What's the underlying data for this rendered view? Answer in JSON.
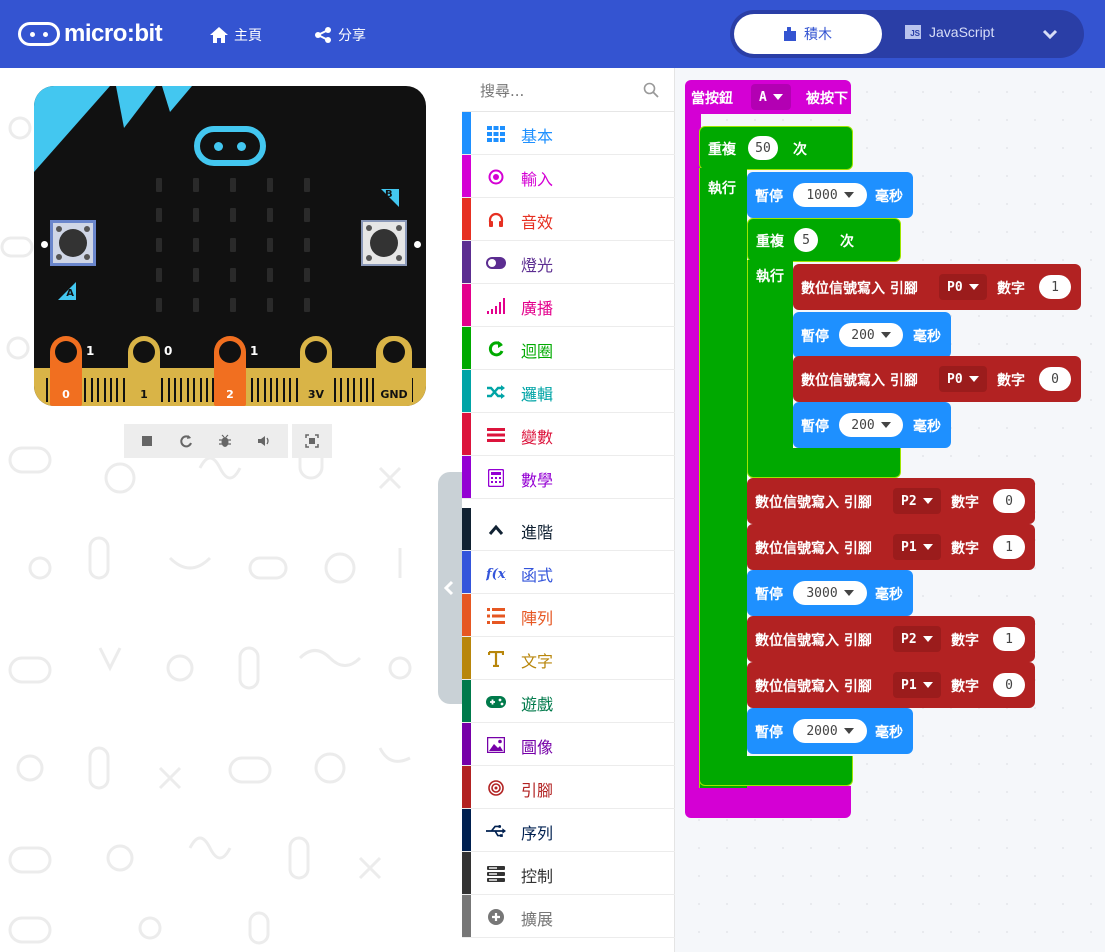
{
  "header": {
    "logo_text": "micro:bit",
    "home_label": "主頁",
    "share_label": "分享",
    "blocks_tab_label": "積木",
    "js_tab_label": "JavaScript",
    "js_badge": "JS"
  },
  "simulator": {
    "button_a_label": "A",
    "button_b_label": "B",
    "pins": [
      {
        "label": "0",
        "value": "1"
      },
      {
        "label": "1",
        "value": "0"
      },
      {
        "label": "2",
        "value": "1"
      },
      {
        "label": "3V"
      },
      {
        "label": "GND"
      }
    ],
    "tools": [
      "stop-icon",
      "restart-icon",
      "debug-icon",
      "sound-icon",
      "screenshot-icon"
    ]
  },
  "toolbox": {
    "search_placeholder": "搜尋...",
    "categories": [
      {
        "label": "基本",
        "color": "#1E90FF",
        "icon": "grid-icon"
      },
      {
        "label": "輸入",
        "color": "#D400D4",
        "icon": "radio-icon"
      },
      {
        "label": "音效",
        "color": "#E63022",
        "icon": "headphones-icon"
      },
      {
        "label": "燈光",
        "color": "#5C2D91",
        "icon": "toggle-icon"
      },
      {
        "label": "廣播",
        "color": "#E3008C",
        "icon": "signal-bars-icon"
      },
      {
        "label": "迴圈",
        "color": "#00AA00",
        "icon": "loop-icon"
      },
      {
        "label": "邏輯",
        "color": "#00A4A6",
        "icon": "shuffle-icon"
      },
      {
        "label": "變數",
        "color": "#DC143C",
        "icon": "list-lines-icon"
      },
      {
        "label": "數學",
        "color": "#9400D3",
        "icon": "calculator-icon"
      },
      {
        "label": "進階",
        "color": "#112233",
        "icon": "chevron-up-icon"
      },
      {
        "label": "函式",
        "color": "#3455DB",
        "icon": "function-icon"
      },
      {
        "label": "陣列",
        "color": "#E65722",
        "icon": "list-icon"
      },
      {
        "label": "文字",
        "color": "#B8860B",
        "icon": "text-icon"
      },
      {
        "label": "遊戲",
        "color": "#007A4B",
        "icon": "gamepad-icon"
      },
      {
        "label": "圖像",
        "color": "#7600A8",
        "icon": "image-icon"
      },
      {
        "label": "引腳",
        "color": "#B22222",
        "icon": "target-icon"
      },
      {
        "label": "序列",
        "color": "#002050",
        "icon": "usb-icon"
      },
      {
        "label": "控制",
        "color": "#333333",
        "icon": "control-icon"
      },
      {
        "label": "擴展",
        "color": "#777777",
        "icon": "plus-circle-icon"
      }
    ]
  },
  "workspace": {
    "event": {
      "prefix": "當按鈕",
      "button": "A",
      "suffix": "被按下"
    },
    "outer_repeat": {
      "label": "重複",
      "count": "50",
      "unit": "次",
      "do": "執行"
    },
    "pause1": {
      "label": "暫停",
      "value": "1000",
      "unit": "毫秒"
    },
    "inner_repeat": {
      "label": "重複",
      "count": "5",
      "unit": "次",
      "do": "執行"
    },
    "write1": {
      "label": "數位信號寫入 引腳",
      "pin": "P0",
      "num_label": "數字",
      "value": "1"
    },
    "pause2": {
      "label": "暫停",
      "value": "200",
      "unit": "毫秒"
    },
    "write2": {
      "label": "數位信號寫入 引腳",
      "pin": "P0",
      "num_label": "數字",
      "value": "0"
    },
    "pause3": {
      "label": "暫停",
      "value": "200",
      "unit": "毫秒"
    },
    "write3": {
      "label": "數位信號寫入 引腳",
      "pin": "P2",
      "num_label": "數字",
      "value": "0"
    },
    "write4": {
      "label": "數位信號寫入 引腳",
      "pin": "P1",
      "num_label": "數字",
      "value": "1"
    },
    "pause4": {
      "label": "暫停",
      "value": "3000",
      "unit": "毫秒"
    },
    "write5": {
      "label": "數位信號寫入 引腳",
      "pin": "P2",
      "num_label": "數字",
      "value": "1"
    },
    "write6": {
      "label": "數位信號寫入 引腳",
      "pin": "P1",
      "num_label": "數字",
      "value": "0"
    },
    "pause5": {
      "label": "暫停",
      "value": "2000",
      "unit": "毫秒"
    }
  }
}
